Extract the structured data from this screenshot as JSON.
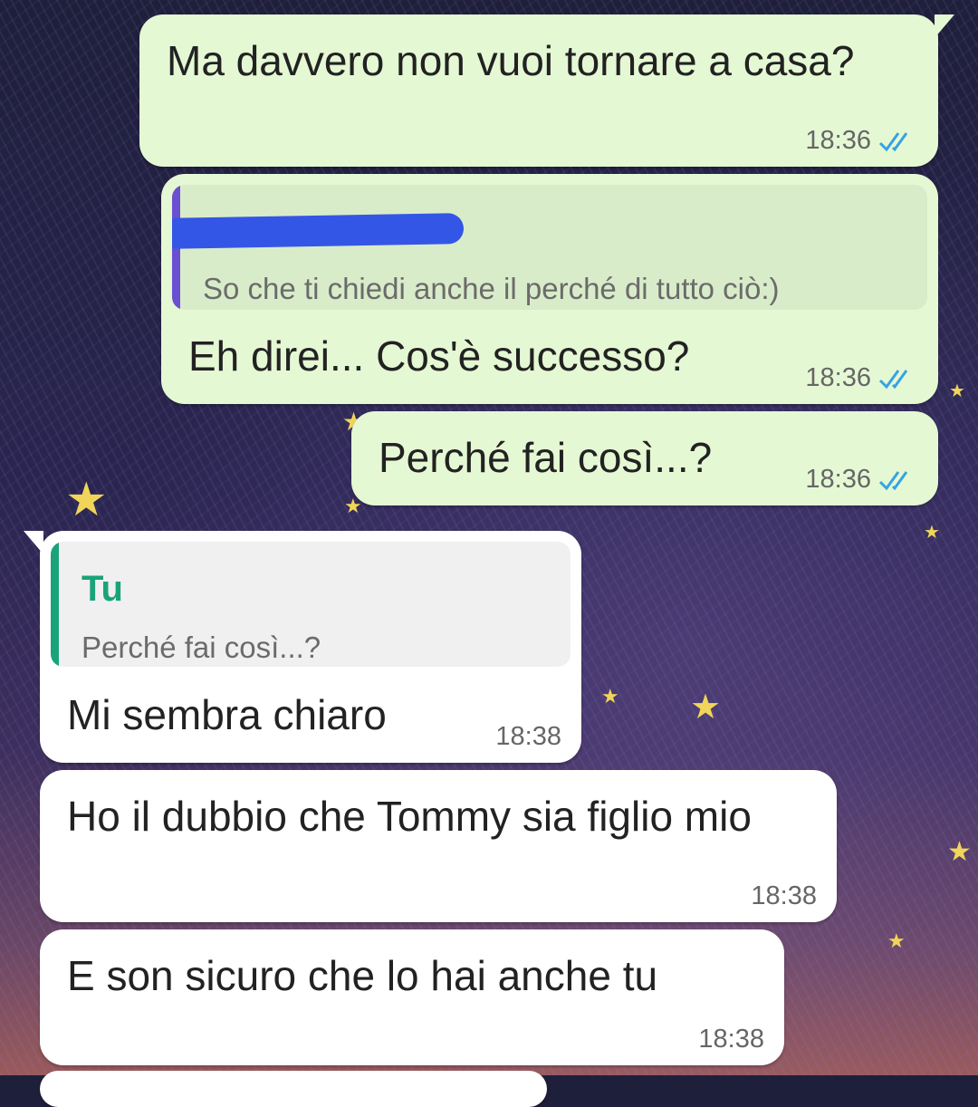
{
  "colors": {
    "outgoing_bubble": "#e5f8d4",
    "incoming_bubble": "#ffffff",
    "read_ticks": "#35a3e4",
    "quote_bar_other": "#6a4fd1",
    "quote_bar_you": "#1aa37a",
    "redaction": "#3456e6"
  },
  "messages": [
    {
      "direction": "outgoing",
      "text": "Ma davvero non vuoi tornare a casa?",
      "time": "18:36",
      "status": "read-icon"
    },
    {
      "direction": "outgoing",
      "quote": {
        "author": "",
        "text": "So che ti chiedi anche il perché di tutto ciò:)"
      },
      "text": "Eh direi... Cos'è successo?",
      "time": "18:36",
      "status": "read-icon"
    },
    {
      "direction": "outgoing",
      "text": "Perché fai così...?",
      "time": "18:36",
      "status": "read-icon"
    },
    {
      "direction": "incoming",
      "quote": {
        "author": "Tu",
        "text": "Perché fai così...?"
      },
      "text": "Mi sembra chiaro",
      "time": "18:38"
    },
    {
      "direction": "incoming",
      "text": "Ho il dubbio che Tommy sia figlio mio",
      "time": "18:38"
    },
    {
      "direction": "incoming",
      "text": "E son sicuro che lo hai anche tu",
      "time": "18:38"
    }
  ]
}
